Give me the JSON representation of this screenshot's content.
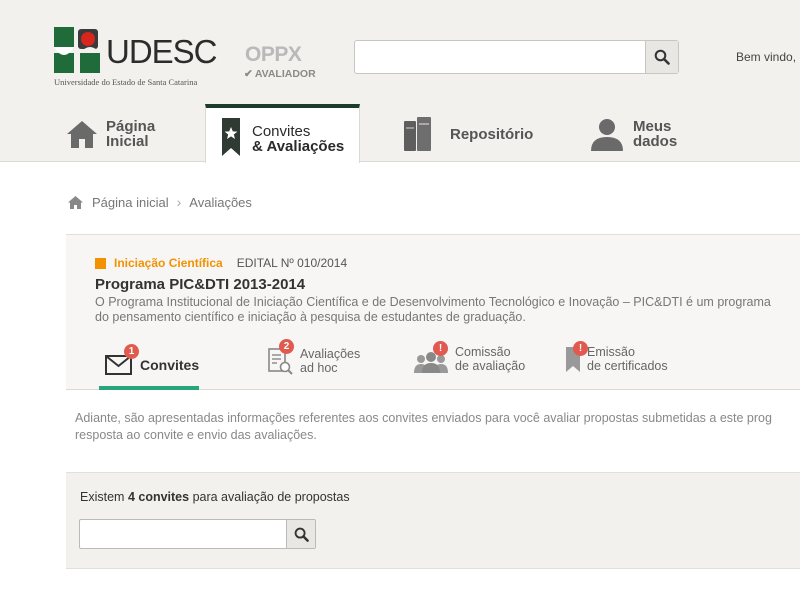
{
  "logo": {
    "name": "UDESC",
    "subtitle": "Universidade do Estado de Santa Catarina"
  },
  "product": {
    "name": "OPPX",
    "role": "AVALIADOR"
  },
  "header": {
    "search_placeholder": "",
    "welcome": "Bem vindo,"
  },
  "nav": {
    "home": {
      "line1": "Página",
      "line2": "Inicial",
      "icon": "house-icon"
    },
    "convites": {
      "line1": "Convites",
      "line2": "& Avaliações",
      "icon": "bookmark-star-icon"
    },
    "repositorio": {
      "label": "Repositório",
      "icon": "books-icon"
    },
    "meus_dados": {
      "line1": "Meus",
      "line2": "dados",
      "icon": "user-icon"
    }
  },
  "breadcrumb": {
    "home": "Página inicial",
    "current": "Avaliações"
  },
  "program": {
    "category": "Iniciação Científica",
    "edital": "EDITAL Nº 010/2014",
    "title": "Programa PIC&DTI 2013-2014",
    "desc_line1": "O Programa Institucional de Iniciação Científica e de Desenvolvimento Tecnológico e Inovação – PIC&DTI é um programa",
    "desc_line2": "do pensamento científico e iniciação à pesquisa de estudantes de graduação."
  },
  "subtabs": {
    "convites": {
      "label": "Convites",
      "badge": "1"
    },
    "adhoc": {
      "line1": "Avaliações",
      "line2": "ad hoc",
      "badge": "2"
    },
    "comissao": {
      "line1": "Comissão",
      "line2": "de avaliação",
      "badge": "!"
    },
    "emissao": {
      "line1": "Emissão",
      "line2": "de certificados",
      "badge": "!"
    }
  },
  "intro": {
    "line1": "Adiante, são apresentadas informações referentes aos convites enviados para você avaliar propostas submetidas a este prog",
    "line2": "resposta ao convite e envio das avaliações."
  },
  "count": {
    "prefix": "Existem",
    "value": "4 convites",
    "suffix": "para avaliação de propostas"
  },
  "colors": {
    "accent_orange": "#f39200",
    "accent_green": "#2aa57b",
    "nav_dark": "#1c3d2a",
    "badge_red": "#e05a50"
  }
}
